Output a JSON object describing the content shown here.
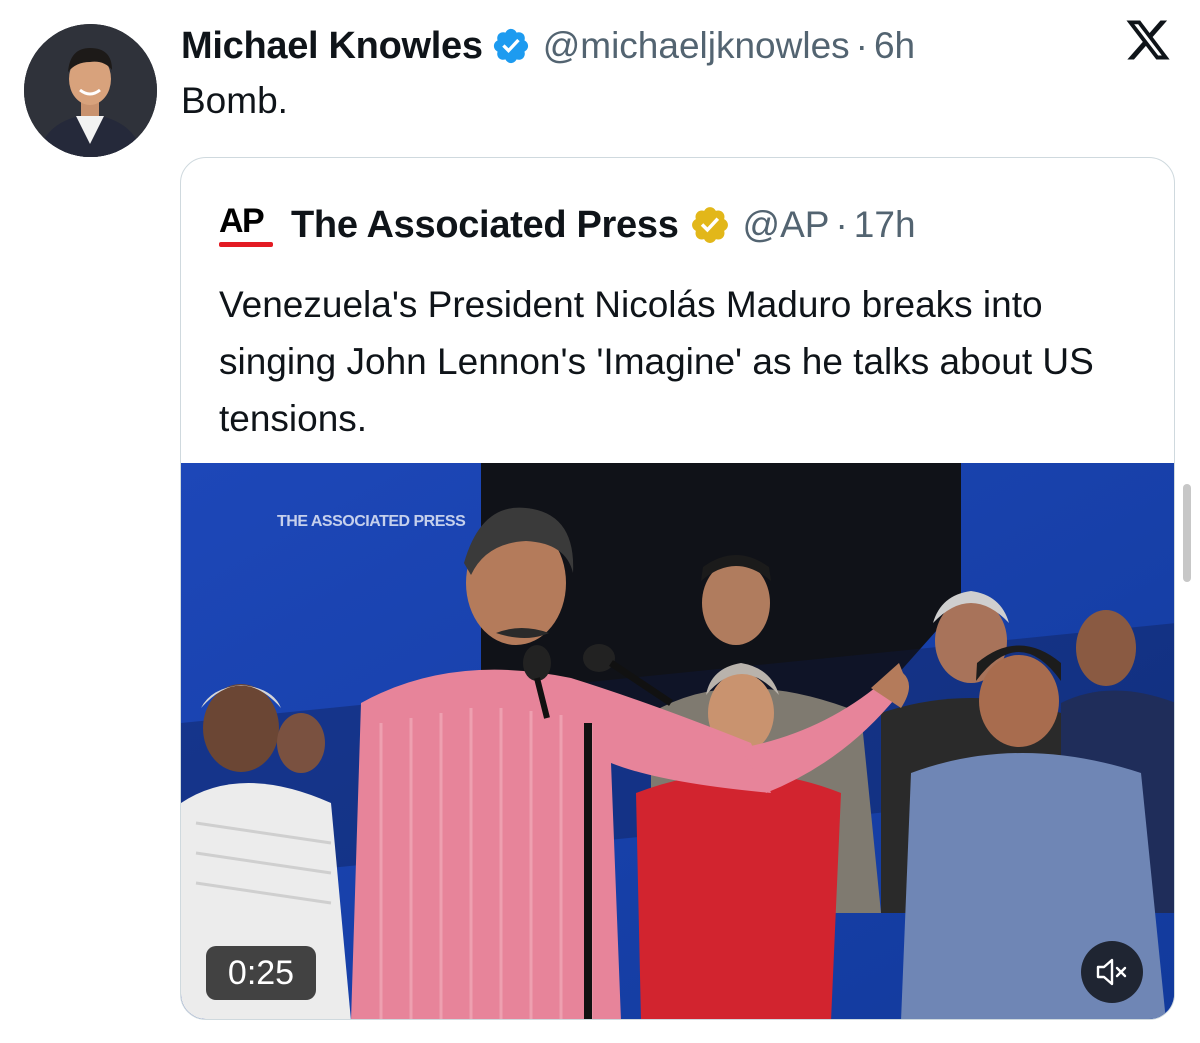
{
  "tweet": {
    "author_name": "Michael Knowles",
    "handle": "@michaeljknowles",
    "separator": "·",
    "time": "6h",
    "text": "Bomb.",
    "avatar_icon": "profile-photo"
  },
  "app": {
    "logo_icon": "x-logo"
  },
  "quoted_tweet": {
    "logo_text": "AP",
    "author_name": "The Associated Press",
    "handle": "@AP",
    "separator": "·",
    "time": "17h",
    "text": "Venezuela's President Nicolás Maduro breaks into singing John Lennon's 'Imagine' as he talks about US tensions.",
    "media": {
      "watermark": "THE ASSOCIATED PRESS",
      "duration": "0:25",
      "mute_icon": "speaker-muted-icon"
    }
  },
  "colors": {
    "verified_blue": "#1d9bf0",
    "verified_gold": "#e2b719",
    "ap_red": "#e31b23",
    "secondary_text": "#536471",
    "border": "#cfd9de"
  }
}
